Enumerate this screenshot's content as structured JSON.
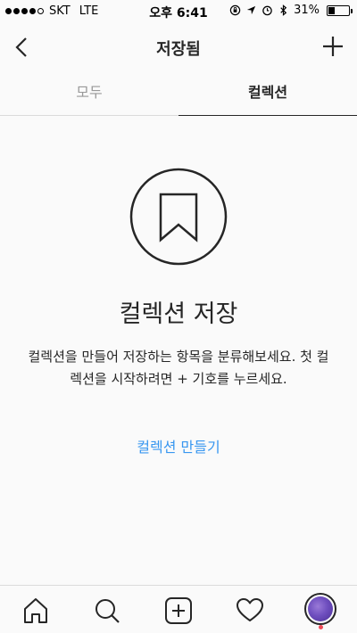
{
  "status_bar": {
    "carrier": "SKT",
    "network": "LTE",
    "time": "오후 6:41",
    "battery_percent": "31%",
    "battery_level": 0.31
  },
  "header": {
    "title": "저장됨",
    "back_icon": "chevron-left-icon",
    "add_icon": "plus-icon"
  },
  "tabs": [
    {
      "label": "모두",
      "active": false
    },
    {
      "label": "컬렉션",
      "active": true
    }
  ],
  "empty_state": {
    "icon": "bookmark-icon",
    "title": "컬렉션 저장",
    "description": "컬렉션을 만들어 저장하는 항목을 분류해보세요. 첫 컬렉션을 시작하려면 + 기호를 누르세요.",
    "action_label": "컬렉션 만들기"
  },
  "bottom_nav": {
    "items": [
      "home-icon",
      "search-icon",
      "add-post-icon",
      "heart-icon",
      "profile-avatar"
    ]
  },
  "colors": {
    "accent": "#3897f0",
    "text": "#262626",
    "muted": "#999999",
    "divider": "#dbdbdb",
    "notification": "#ed4956"
  }
}
